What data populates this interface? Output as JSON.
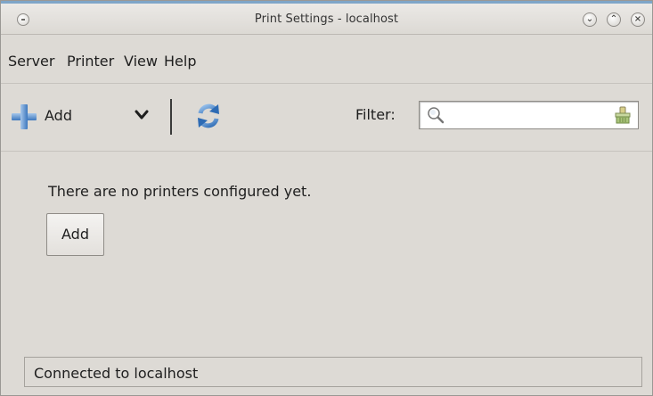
{
  "window": {
    "title": "Print Settings - localhost"
  },
  "menubar": {
    "items": [
      "Server",
      "Printer",
      "View",
      "Help"
    ]
  },
  "toolbar": {
    "add_label": "Add",
    "filter_label": "Filter:",
    "filter_value": "",
    "icons": [
      "plus-icon",
      "chevron-down-icon",
      "refresh-icon",
      "search-icon",
      "clear-icon"
    ]
  },
  "main": {
    "empty_message": "There are no printers configured yet.",
    "add_button_label": "Add"
  },
  "statusbar": {
    "text": "Connected to localhost"
  },
  "colors": {
    "accent": "#3e78be",
    "window_bg": "#dddad5",
    "titlebar_top": "#7ea5c8"
  }
}
